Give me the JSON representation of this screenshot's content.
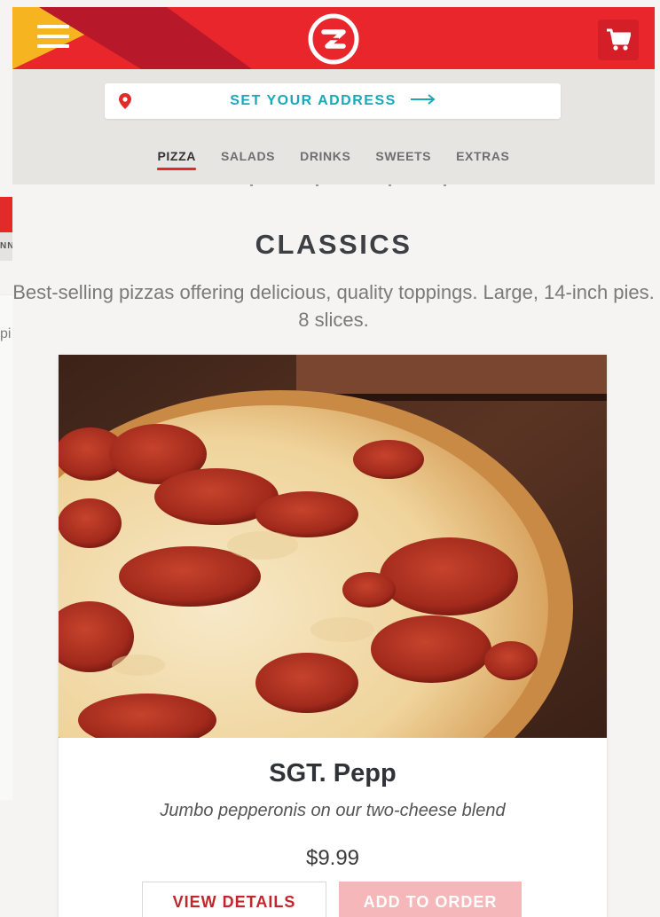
{
  "header": {
    "menu_icon": "hamburger-menu-icon",
    "logo_icon": "brand-logo-icon",
    "cart_icon": "shopping-cart-icon",
    "colors": {
      "red": "#e8262b",
      "yellow": "#f6b520",
      "dark_red": "#b7192a"
    }
  },
  "address": {
    "label": "SET YOUR ADDRESS",
    "pin_icon": "location-pin-icon",
    "arrow_icon": "arrow-right-icon",
    "accent": "#1aa8b8"
  },
  "categories": {
    "active": "PIZZA",
    "tabs": [
      "PIZZA",
      "SALADS",
      "DRINKS",
      "SWEETS",
      "EXTRAS"
    ]
  },
  "ghost": {
    "nav_fragment": "NNK",
    "text_fragment": "pi"
  },
  "section": {
    "title": "CLASSICS",
    "description": "Best-selling pizzas offering delicious, quality toppings. Large, 14-inch pies. 8 slices."
  },
  "product": {
    "image_icon": "pepperoni-pizza-photo",
    "name": "SGT. Pepp",
    "description": "Jumbo pepperonis on our two-cheese blend",
    "price": "$9.99",
    "details_label": "VIEW DETAILS",
    "add_label": "ADD TO ORDER"
  }
}
